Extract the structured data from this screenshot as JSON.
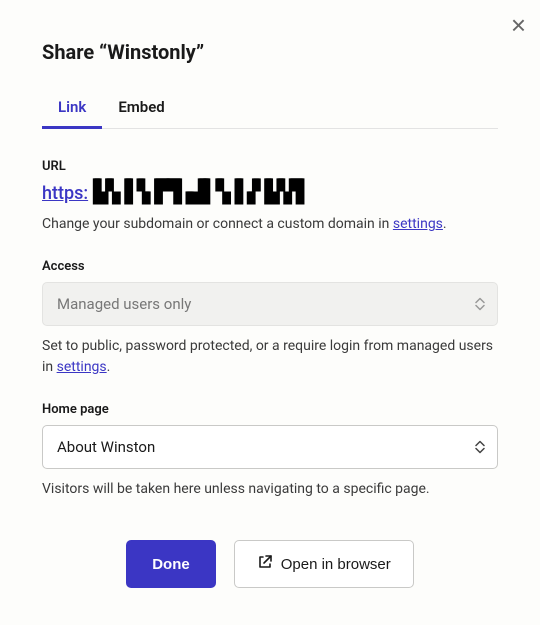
{
  "close_label": "×",
  "title": "Share “Winstonly”",
  "tabs": {
    "link": "Link",
    "embed": "Embed"
  },
  "url": {
    "label": "URL",
    "prefix": "https:",
    "redacted": "▙▚▐▝▖▛▜▗▟▍▚▐▗▘▙▚▜",
    "helper_pre": "Change your subdomain or connect a custom domain in ",
    "helper_link": "settings",
    "helper_post": "."
  },
  "access": {
    "label": "Access",
    "value": "Managed users only",
    "helper_pre": "Set to public, password protected, or a require login from managed users in ",
    "helper_link": "settings",
    "helper_post": "."
  },
  "home": {
    "label": "Home page",
    "value": "About Winston",
    "helper": "Visitors will be taken here unless navigating to a specific page."
  },
  "footer": {
    "done": "Done",
    "open": "Open in browser"
  }
}
